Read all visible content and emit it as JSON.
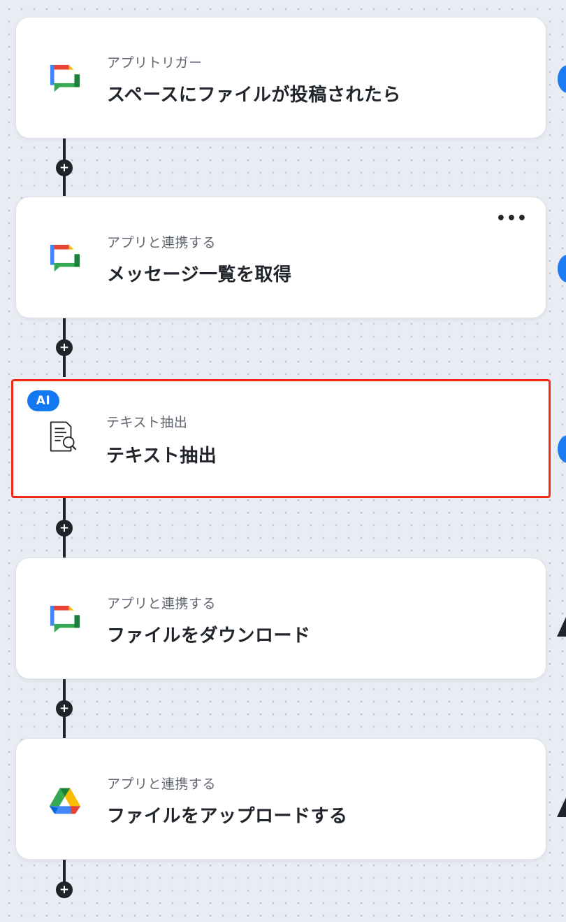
{
  "flow": {
    "steps": [
      {
        "type_label": "アプリトリガー",
        "title": "スペースにファイルが投稿されたら",
        "icon": "google-chat-icon"
      },
      {
        "type_label": "アプリと連携する",
        "title": "メッセージ一覧を取得",
        "icon": "google-chat-icon",
        "more_label": "•••"
      },
      {
        "type_label": "テキスト抽出",
        "title": "テキスト抽出",
        "icon": "document-search-icon",
        "badge": "AI",
        "selected": true
      },
      {
        "type_label": "アプリと連携する",
        "title": "ファイルをダウンロード",
        "icon": "google-chat-icon"
      },
      {
        "type_label": "アプリと連携する",
        "title": "ファイルをアップロードする",
        "icon": "google-drive-icon"
      }
    ],
    "add_label": "+"
  },
  "colors": {
    "highlight_border": "#f02a12",
    "ai_badge": "#1478f0",
    "connector": "#1f232a"
  }
}
